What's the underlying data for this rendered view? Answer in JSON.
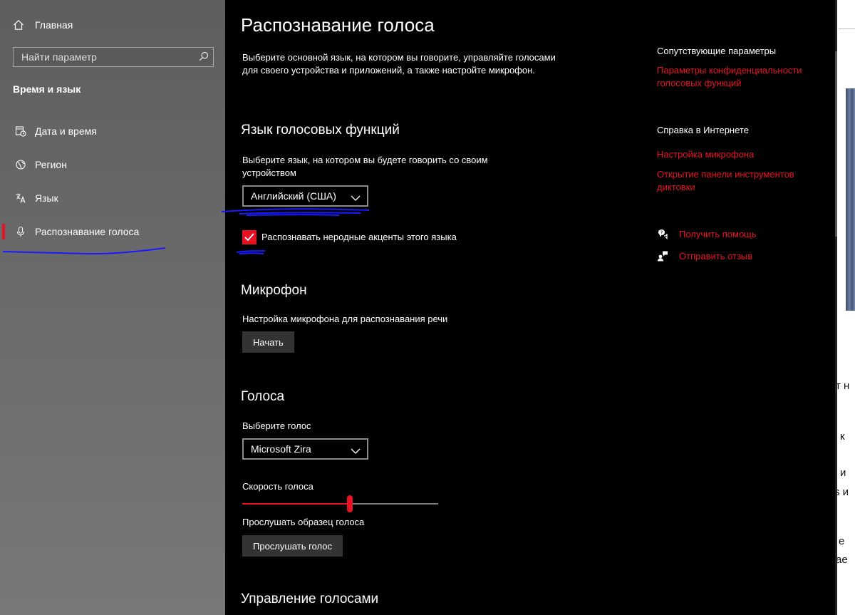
{
  "sidebar": {
    "home_label": "Главная",
    "search_placeholder": "Найти параметр",
    "section_title": "Время и язык",
    "items": [
      {
        "label": "Дата и время",
        "icon": "clock-calendar-icon"
      },
      {
        "label": "Регион",
        "icon": "globe-icon"
      },
      {
        "label": "Язык",
        "icon": "language-icon"
      },
      {
        "label": "Распознавание голоса",
        "icon": "microphone-icon",
        "selected": true
      }
    ]
  },
  "main": {
    "title": "Распознавание голоса",
    "description": "Выберите основной язык, на котором вы говорите, управляйте голосами для своего устройства и приложений, а также настройте микрофон.",
    "speech_language": {
      "heading": "Язык голосовых функций",
      "label": "Выберите язык, на котором вы будете говорить со своим устройством",
      "selected": "Английский (США)",
      "checkbox_label": "Распознавать неродные акценты этого языка",
      "checkbox_checked": true
    },
    "microphone": {
      "heading": "Микрофон",
      "label": "Настройка микрофона для распознавания речи",
      "button": "Начать"
    },
    "voices": {
      "heading": "Голоса",
      "label": "Выберите голос",
      "selected": "Microsoft Zira",
      "speed_label": "Скорость голоса",
      "speed_value": 0.55,
      "sample_label": "Прослушать образец голоса",
      "sample_button": "Прослушать голос"
    },
    "manage_voices": {
      "heading": "Управление голосами"
    }
  },
  "related": {
    "title": "Сопутствующие параметры",
    "privacy_link": "Параметры конфиденциальности голосовых функций",
    "web_help_title": "Справка в Интернете",
    "mic_setup_link": "Настройка микрофона",
    "dictation_link": "Открытие панели инструментов диктовки",
    "get_help": "Получить помощь",
    "send_feedback": "Отправить отзыв"
  },
  "background_window": {
    "fragments": [
      "т н",
      "к",
      "и",
      "s и",
      "е",
      "ае"
    ]
  },
  "colors": {
    "accent": "#e81123",
    "sidebar_bg": "#666666",
    "main_bg": "#000000",
    "annotation_scribble": "#1a1aff"
  }
}
